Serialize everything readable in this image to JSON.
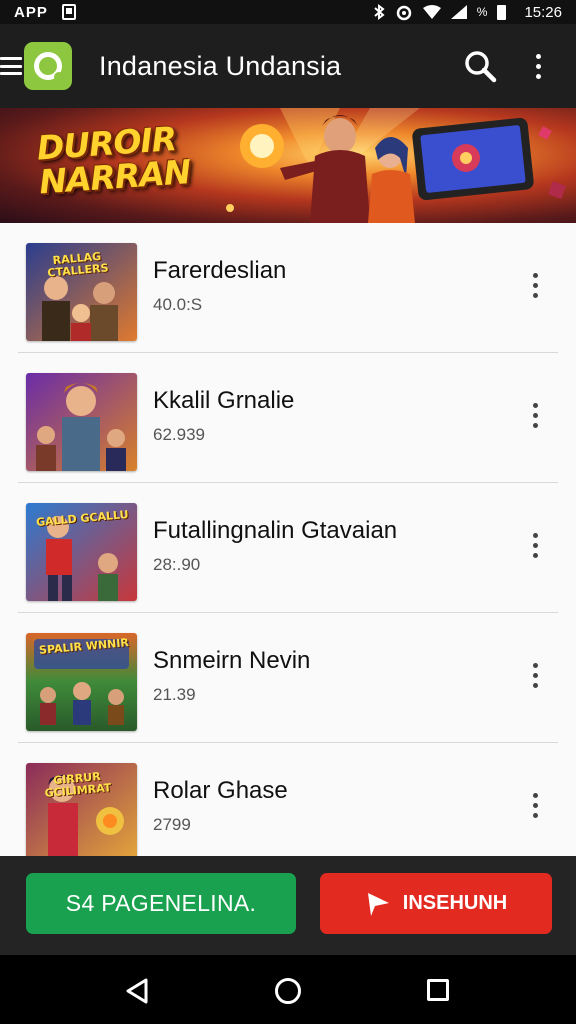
{
  "status_bar": {
    "carrier": "APP",
    "time": "15:26",
    "percent": "%",
    "icons": [
      "document-icon",
      "bluetooth-icon",
      "alarm-icon",
      "wifi-icon",
      "signal-icon",
      "battery-icon"
    ]
  },
  "app_bar": {
    "title": "Indanesia Undansia",
    "icons": [
      "hamburger-icon",
      "app-logo",
      "search-icon",
      "more-vert-icon"
    ]
  },
  "banner": {
    "title": "DUROIR NARRAN"
  },
  "games": [
    {
      "title": "Farerdeslian",
      "subtitle": "40.0:S",
      "thumb_text": "RALLAG CTALLERS",
      "colors": [
        "#2a3d8f",
        "#e07a2e"
      ]
    },
    {
      "title": "Kkalil Grnalie",
      "subtitle": "62.939",
      "thumb_text": "",
      "colors": [
        "#6a2ca8",
        "#d9812a"
      ]
    },
    {
      "title": "Futallingnalin Gtavaian",
      "subtitle": "28:.90",
      "thumb_text": "GALLD GCALLU",
      "colors": [
        "#2c7bd1",
        "#c8373a"
      ]
    },
    {
      "title": "Snmeirn Nevin",
      "subtitle": "21.39",
      "thumb_text": "SPALIR WNNIR",
      "colors": [
        "#3f8a3a",
        "#d9662a"
      ]
    },
    {
      "title": "Rolar Ghase",
      "subtitle": "2799",
      "thumb_text": "GIRRUR GCILIMRAT",
      "colors": [
        "#8a2c5a",
        "#e5a63a"
      ]
    }
  ],
  "actions": {
    "primary_label": "S4 PAGENELINA.",
    "secondary_label": "INSEHUNH",
    "primary_color": "#1aa14f",
    "secondary_color": "#e22a20"
  },
  "nav_bar": {
    "icons": [
      "back-icon",
      "home-icon",
      "recents-icon"
    ]
  }
}
